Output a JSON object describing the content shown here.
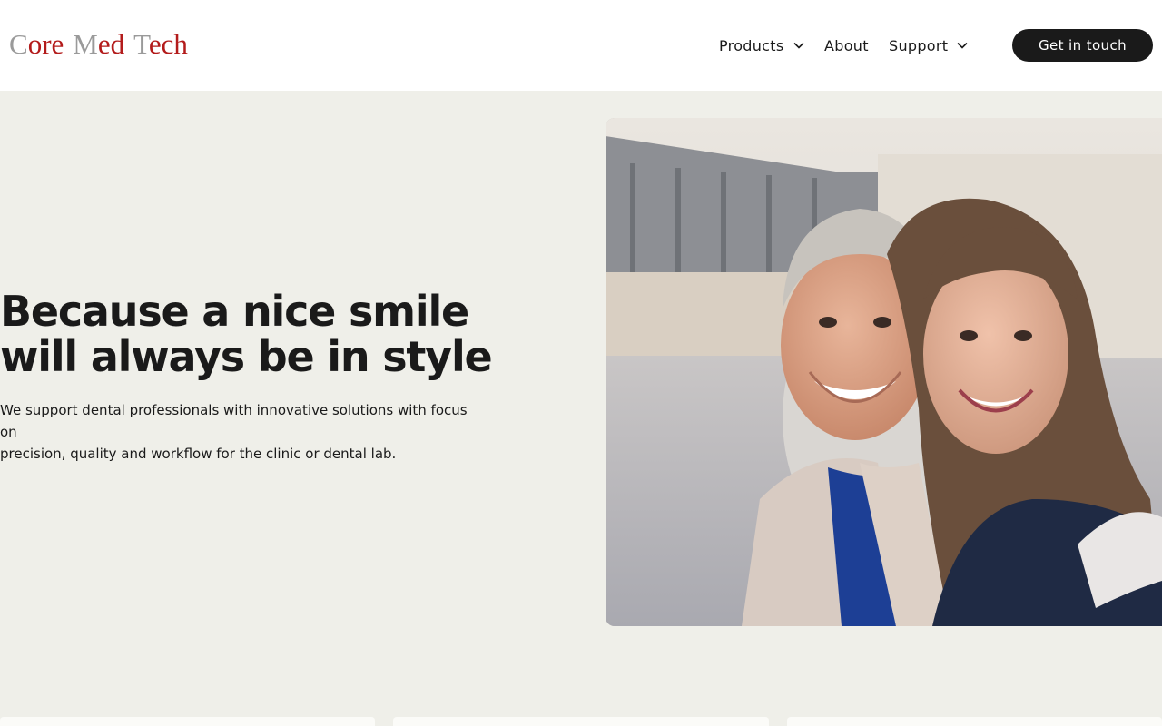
{
  "brand": {
    "logo_parts": [
      {
        "cap": "C",
        "rest": "ore"
      },
      {
        "cap": "M",
        "rest": "ed"
      },
      {
        "cap": "T",
        "rest": "ech"
      }
    ]
  },
  "nav": {
    "products_label": "Products",
    "about_label": "About",
    "support_label": "Support",
    "cta_label": "Get in touch"
  },
  "hero": {
    "headline_line1": "Because a nice smile",
    "headline_line2": "will always be in style",
    "description_line1": "We support dental professionals with innovative solutions with focus on",
    "description_line2": "precision, quality and workflow for the clinic or dental lab."
  },
  "colors": {
    "background": "#efefe9",
    "header": "#ffffff",
    "brand_red": "#b31b1b",
    "brand_gray": "#9a9a9a",
    "cta": "#1a1a1a"
  }
}
